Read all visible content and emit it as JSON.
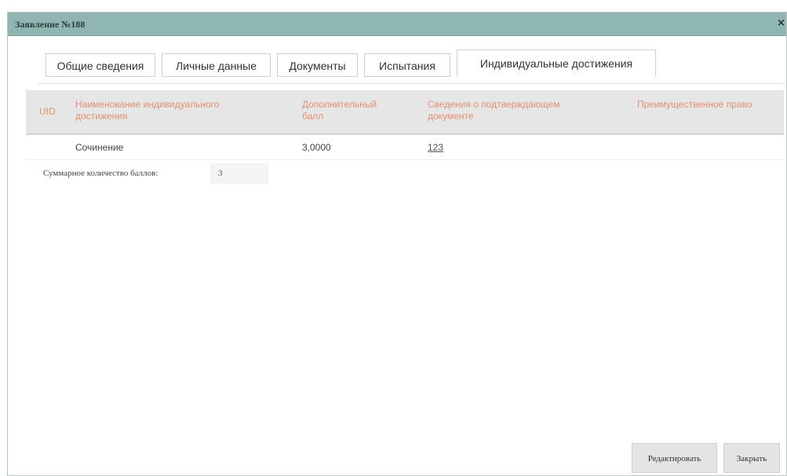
{
  "dialog": {
    "title": "Заявление №188",
    "close_icon": "×"
  },
  "tabs": [
    {
      "label": "Общие сведения"
    },
    {
      "label": "Личные данные"
    },
    {
      "label": "Документы"
    },
    {
      "label": "Испытания"
    },
    {
      "label": "Индивидуальные достижения",
      "active": true
    }
  ],
  "table": {
    "headers": [
      "UID",
      "Наименование индивидуального достижения",
      "Дополнительный балл",
      "Сведения о подтверждающем документе",
      "Преимущественное право"
    ],
    "rows": [
      {
        "uid": "",
        "name": "Сочинение",
        "score": "3,0000",
        "document": "123",
        "priority": ""
      }
    ]
  },
  "total": {
    "label": "Суммарное количество баллов:",
    "value": "3"
  },
  "buttons": {
    "edit_label": "Редактировать",
    "close_label": "Закрыть"
  },
  "colors": {
    "titlebar": "#8fb6b1",
    "header_text": "#e2906f",
    "header_bg": "#e6e6e6"
  }
}
